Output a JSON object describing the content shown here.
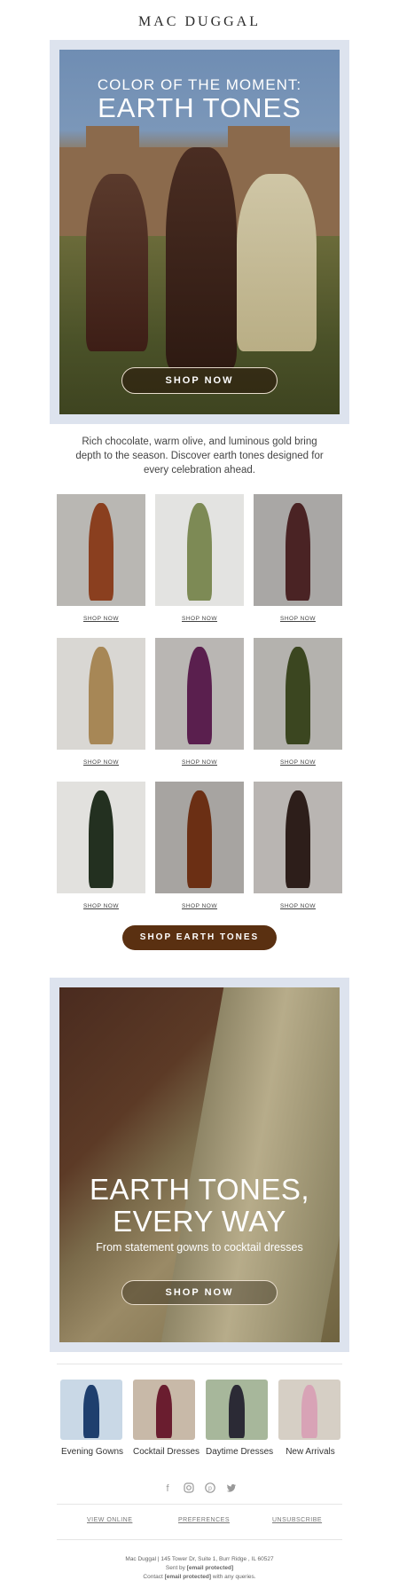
{
  "brand": "MAC DUGGAL",
  "hero": {
    "eyebrow": "COLOR OF THE MOMENT:",
    "title": "EARTH TONES",
    "button": "SHOP NOW"
  },
  "intro": "Rich chocolate, warm olive, and luminous gold bring depth to the season. Discover earth tones designed for every celebration ahead.",
  "products": [
    {
      "link": "SHOP NOW",
      "bg": "#b9b7b3",
      "dress": "#8a3f1f"
    },
    {
      "link": "SHOP NOW",
      "bg": "#e3e3e1",
      "dress": "#7d8a55"
    },
    {
      "link": "SHOP NOW",
      "bg": "#a9a7a5",
      "dress": "#4a2324"
    },
    {
      "link": "SHOP NOW",
      "bg": "#d9d7d3",
      "dress": "#a78756"
    },
    {
      "link": "SHOP NOW",
      "bg": "#b9b6b3",
      "dress": "#5a1f4e"
    },
    {
      "link": "SHOP NOW",
      "bg": "#b4b2ae",
      "dress": "#3b4620"
    },
    {
      "link": "SHOP NOW",
      "bg": "#e2e1de",
      "dress": "#233020"
    },
    {
      "link": "SHOP NOW",
      "bg": "#a7a4a1",
      "dress": "#6b2f14"
    },
    {
      "link": "SHOP NOW",
      "bg": "#b9b5b2",
      "dress": "#2d1e1a"
    }
  ],
  "cta": "SHOP EARTH TONES",
  "feature": {
    "title_line1": "EARTH TONES,",
    "title_line2": "EVERY WAY",
    "subtitle": "From statement gowns to cocktail dresses",
    "button": "SHOP NOW"
  },
  "categories": [
    {
      "label": "Evening Gowns",
      "bg": "#c9d8e6",
      "fig": "#1e3f6e"
    },
    {
      "label": "Cocktail Dresses",
      "bg": "#c8b9a8",
      "fig": "#6a1d2f"
    },
    {
      "label": "Daytime Dresses",
      "bg": "#a7b79b",
      "fig": "#2b2a35"
    },
    {
      "label": "New Arrivals",
      "bg": "#d6cfc5",
      "fig": "#d8a3b6"
    }
  ],
  "social_icons": [
    "facebook-icon",
    "instagram-icon",
    "pinterest-icon",
    "twitter-icon"
  ],
  "footer_links": {
    "view_online": "VIEW ONLINE",
    "preferences": "PREFERENCES",
    "unsubscribe": "UNSUBSCRIBE"
  },
  "address": {
    "line1": "Mac Duggal | 145 Tower Dr, Suite 1, Burr Ridge , IL 60527",
    "sent_by_prefix": "Sent by",
    "sent_by_email": "[email protected]",
    "contact_prefix": "Contact",
    "contact_email": "[email protected]",
    "contact_suffix": "with any queries."
  }
}
